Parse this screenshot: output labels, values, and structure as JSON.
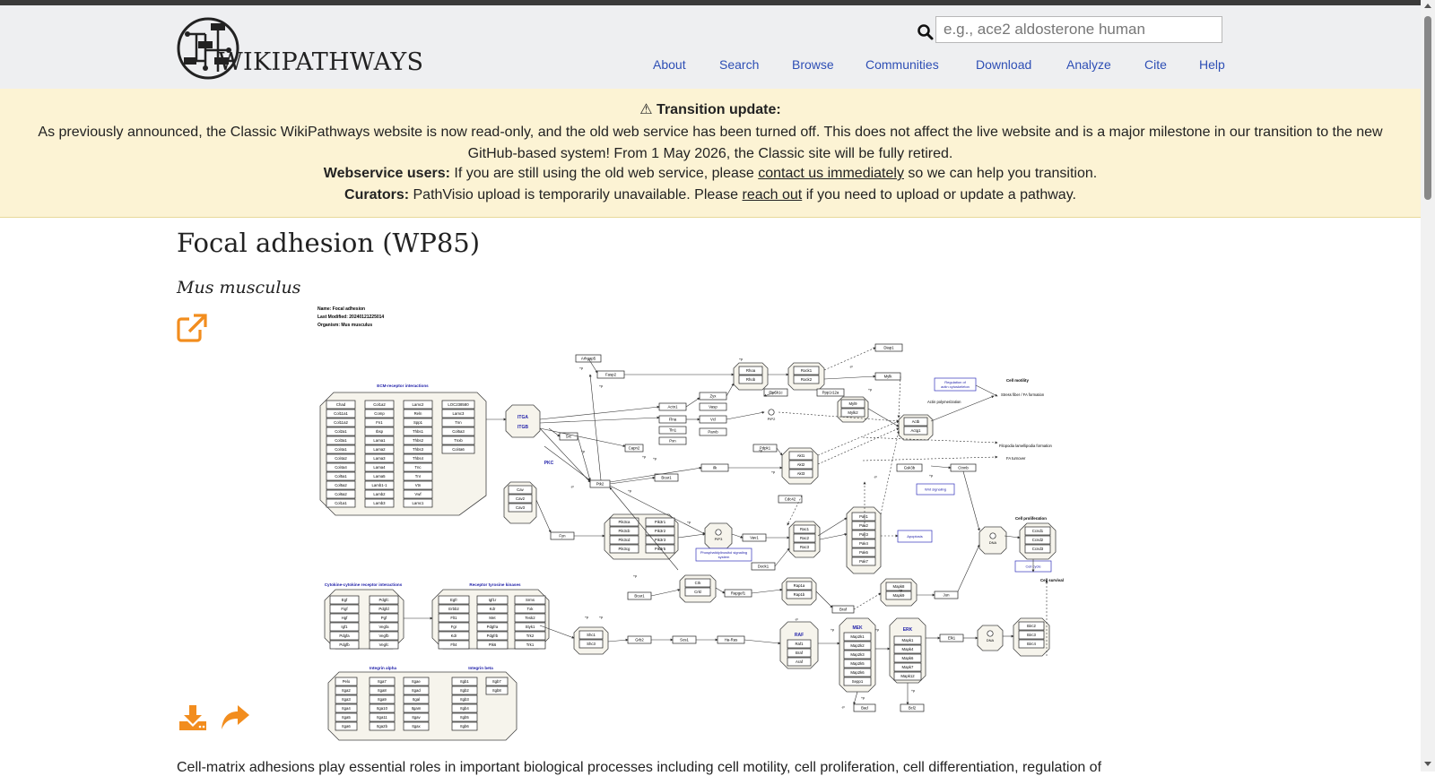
{
  "header": {
    "logo_text": "WIKIPATHWAYS",
    "search": {
      "placeholder": "e.g., ace2 aldosterone human",
      "value": ""
    },
    "nav": [
      {
        "label": "About"
      },
      {
        "label": "Search"
      },
      {
        "label": "Browse"
      },
      {
        "label": "Communities"
      },
      {
        "label": "Download"
      },
      {
        "label": "Analyze"
      },
      {
        "label": "Cite"
      },
      {
        "label": "Help"
      }
    ]
  },
  "banner": {
    "title": "⚠ Transition update:",
    "body": "As previously announced, the Classic WikiPathways website is now read-only, and the old web service has been turned off. This does not affect the live website and is a major milestone in our transition to the new GitHub-based system! From 1 May 2026, the Classic site will be fully retired.",
    "webservice_label": "Webservice users:",
    "webservice_text_before": " If you are still using the old web service, please ",
    "webservice_link": "contact us immediately",
    "webservice_text_after": " so we can help you transition.",
    "curators_label": "Curators:",
    "curators_text_before": " PathVisio upload is temporarily unavailable. Please ",
    "curators_link": "reach out",
    "curators_text_after": " if you need to upload or update a pathway."
  },
  "page": {
    "title": "Focal adhesion (WP85)",
    "organism": "Mus musculus",
    "description": "Cell-matrix adhesions play essential roles in important biological processes including cell motility, cell proliferation, cell differentiation, regulation of"
  },
  "diagram": {
    "meta": [
      "Name: Focal adhesion",
      "Last Modified: 20240121225014",
      "Organism: Mus musculus"
    ],
    "group_labels": {
      "ecm": "ECM-receptor interactions",
      "cytokine": "Cytokine-cytokine receptor interactions",
      "rtk": "Receptor tyrosine kinases",
      "integrin_alpha": "Integrin alpha",
      "integrin_beta": "Integrin beta",
      "pkc": "PKC",
      "raf": "RAF",
      "mek": "MEK",
      "erk": "ERK",
      "itga": "ITGA",
      "itgb": "ITGB"
    },
    "ecm_col1": [
      "Chad",
      "Col11a1",
      "Col11a2",
      "Col2a1",
      "Col3a1",
      "Col4a1",
      "Col4a2",
      "Col4a4",
      "Col5a1",
      "Col5a2",
      "Col6a2",
      "Col1a1"
    ],
    "ecm_col2": [
      "Col1a2",
      "Comp",
      "Fn1",
      "Ibsp",
      "Lama1",
      "Lama2",
      "Lama3",
      "Lama4",
      "Lama5",
      "Lamb1-1",
      "Lamb2",
      "Lamb3"
    ],
    "ecm_col3": [
      "Lamc2",
      "Reln",
      "Spp1",
      "Thbs1",
      "Thbs2",
      "Thbs3",
      "Thbs4",
      "Tnc",
      "Tnr",
      "Vtn",
      "Vwf",
      "Lamc1"
    ],
    "ecm_col4": [
      "LOC238580",
      "Lamc3",
      "Tnn",
      "Col5a3",
      "Tnxb",
      "Col4a6"
    ],
    "cytokine_col1": [
      "Egf",
      "Figf",
      "Hgf",
      "Igf1",
      "Pdgfa",
      "Pdgfb"
    ],
    "cytokine_col2": [
      "Pdgfc",
      "Pdgfd",
      "Pgf",
      "Vegfa",
      "Vegfb",
      "Vegfc"
    ],
    "rtk_col1": [
      "Egfr",
      "Erbb2",
      "Flt1",
      "Fgr",
      "Kdr",
      "Flt4"
    ],
    "rtk_col2": [
      "Igf1r",
      "Kdr",
      "Met",
      "Pdgfra",
      "Pdgfrb",
      "Ptk6"
    ],
    "rtk_col3": [
      "Srms",
      "Txk",
      "Tesk2",
      "Styk1",
      "Trk2",
      "Trk1"
    ],
    "integrin_a_col0": [
      "Pelo",
      "Itga2",
      "Itga3",
      "Itga4",
      "Itga5",
      "Itga6"
    ],
    "integrin_a_col1": [
      "Itga7",
      "Itga8",
      "Itga9",
      "Itga10",
      "Itga11",
      "Itga2b"
    ],
    "integrin_a_col2": [
      "Itgae",
      "Itgad",
      "Itgal",
      "Itgam",
      "Itgav",
      "Itgax"
    ],
    "integrin_b_col1": [
      "Itgb1",
      "Itgb2",
      "Itgb3",
      "Itgb4",
      "Itgb5",
      "Itgb6"
    ],
    "integrin_b_col2": [
      "Itgb7",
      "Itgb8"
    ],
    "nodes": {
      "arhgap5": "Arhgap5",
      "fasp2": "Fasp2",
      "rhoa": "Rhoa",
      "rhob": "Rhob",
      "rock1": "Rock1",
      "rock2": "Rock2",
      "diap1": "Diap1",
      "mylk": "Mylk",
      "pip5k1c": "Pip5k1c",
      "ppp1r12a": "Ppp1r12a",
      "myl9": "Myl9",
      "myl12": "Mylk2",
      "actn1": "Actn1",
      "flna": "Flna",
      "tln1": "Tln1",
      "pxn": "Pxn",
      "zyx": "Zyx",
      "vasp": "Vasp",
      "vcl": "Vcl",
      "parvb": "Parvb",
      "pip2": "PIP2",
      "actb": "Actb",
      "actg1": "Actg1",
      "src": "Src",
      "capn2": "Capn2",
      "pdpk1": "Pdpk1",
      "ptk2": "Ptk2",
      "bcar1": "Bcar1",
      "ilk": "Ilk",
      "cav1": "Cav",
      "cav2": "Cav2",
      "cav3": "Cav3",
      "fyn": "Fyn",
      "pip3": "PIP3",
      "akt1": "Akt1",
      "akt2": "Akt2",
      "akt3": "Akt3",
      "gsk3b": "Gsk3b",
      "ctnnb1": "Ctnnb",
      "cdc42": "Cdc42",
      "pik3ca": "Pik3ca",
      "pik3cb": "Pik3cb",
      "pik3cd": "Pik3cd",
      "pik3cg": "Pik3cg",
      "pik3r1": "Pik3r1",
      "pik3r2": "Pik3r2",
      "pik3r3": "Pik3r3",
      "pik3r5": "Pik3r5",
      "rac1": "Rac1",
      "rac2": "Rac2",
      "rac3": "Rac3",
      "vav1": "Vav1",
      "dock1": "Dock1",
      "pak1": "Pak1",
      "pak2": "Pak2",
      "pak3": "Pak3",
      "pak4": "Pak4",
      "pak6": "Pak6",
      "pak7": "Pak7",
      "crk": "Crk",
      "crkl": "Crkl",
      "rapgef1": "Rapgef1",
      "rap1a": "Rap1a",
      "rap1b": "Rap1b",
      "braf_top": "Braf",
      "mapk8": "Mapk8",
      "mapk9": "Mapk9",
      "jun": "Jun",
      "dna1": "DNA",
      "dna2": "DNA",
      "ccnd1": "Ccnd1",
      "ccnd2": "Ccnd2",
      "ccnd3": "Ccnd3",
      "shc1": "Shc1",
      "shc3": "Shc3",
      "grb2": "Grb2",
      "sos1": "Sos1",
      "hras": "Ha-Ras",
      "raf1": "Raf1",
      "braf": "Braf",
      "araf": "Araf",
      "map2k1": "Map2k1",
      "map2k2": "Map2k2",
      "map2k3": "Map2k3",
      "map2k5": "Map2k5",
      "map2k6": "Map2k6",
      "sepp1": "Sepp1",
      "mapk1": "Mapk1",
      "mapk4": "Mapk4",
      "mapk6": "Mapk6",
      "mapk7": "Mapk7",
      "mapk12": "Mapk12",
      "elk1": "Elk1",
      "birc2": "Birc2",
      "birc3": "Birc3",
      "birc4": "Birc4",
      "bad": "Bad",
      "bcl2": "Bcl2"
    },
    "links": {
      "actin_reg": "Regulation of actin cytoskeleton",
      "pi3k": "Phosphatidylinositol signaling system",
      "wnt": "Wnt signaling",
      "apoptosis": "Apoptosis",
      "cell_cycle": "Cell cycle"
    },
    "annotations": {
      "cell_motility": "Cell motility",
      "stress_fiber": "Stress fiber / FA formation",
      "actin_poly": "Actin polymerization",
      "filopodia": "Filopodia lamellipodia formation",
      "fa_turnover": "FA turnover",
      "cell_prolif": "Cell proliferation",
      "cell_survival": "Cell survival",
      "plus_p": "+p",
      "minus_p": "-p"
    }
  }
}
